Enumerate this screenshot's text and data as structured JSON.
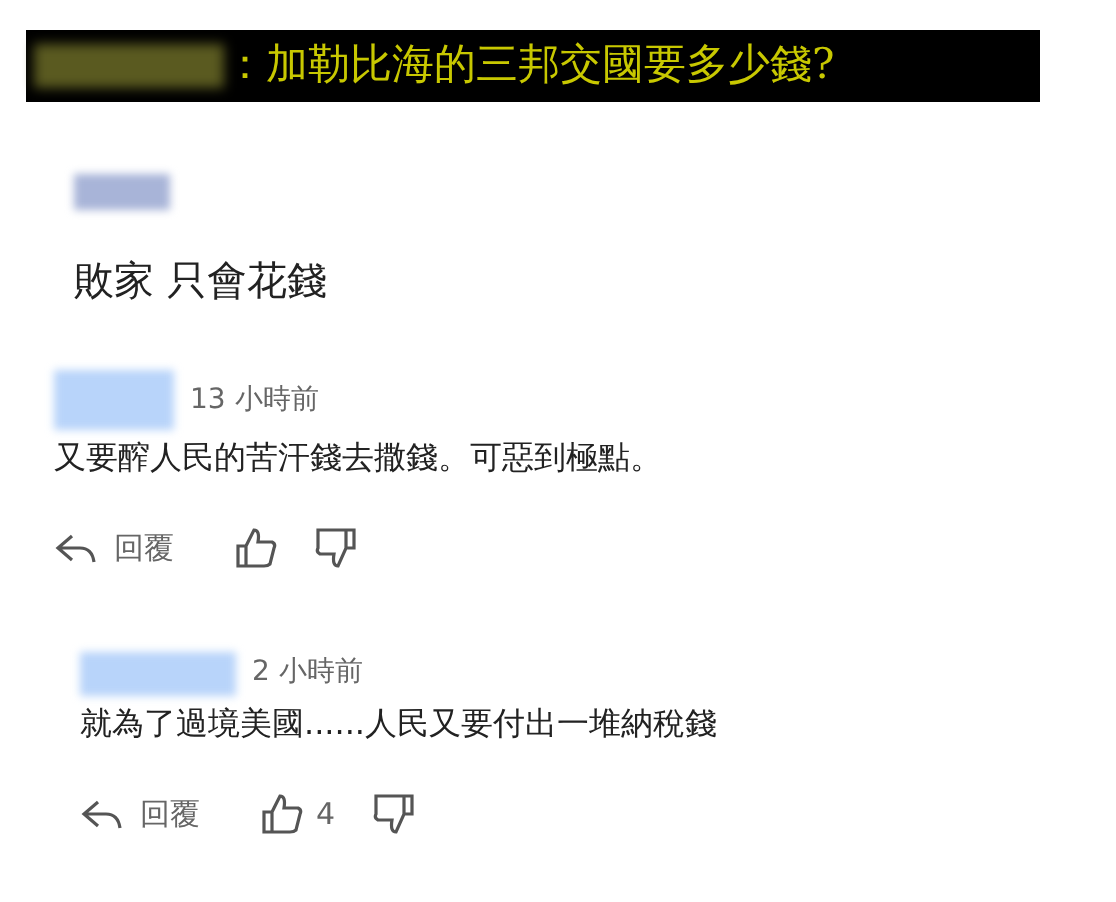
{
  "headline": {
    "text": "：加勒比海的三邦交國要多少錢?"
  },
  "comments": [
    {
      "kind": "plain",
      "text": "敗家 只會花錢"
    },
    {
      "kind": "full",
      "time": "13 小時前",
      "text": "又要醡人民的苦汗錢去撒錢。可惡到極點。",
      "reply_label": "回覆"
    },
    {
      "kind": "full",
      "time": "2 小時前",
      "text": "就為了過境美國......人民又要付出一堆納稅錢",
      "reply_label": "回覆",
      "likes": "4"
    }
  ]
}
